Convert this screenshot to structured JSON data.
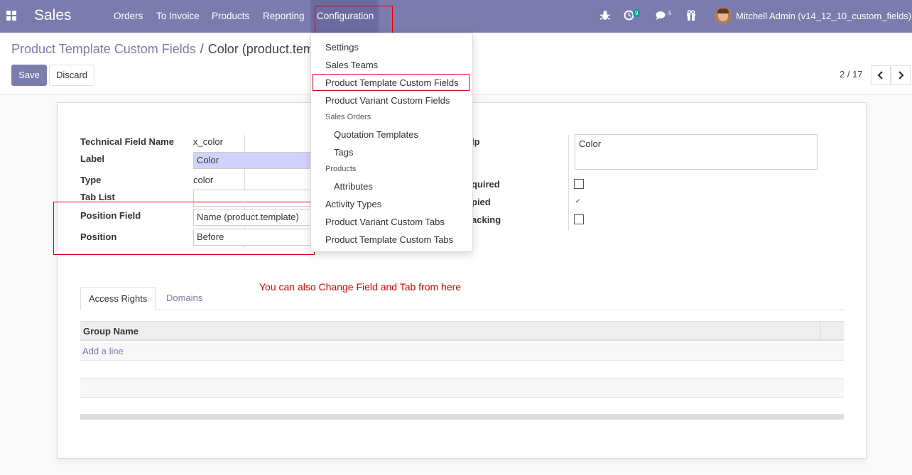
{
  "navbar": {
    "app_name": "Sales",
    "menu": [
      "Orders",
      "To Invoice",
      "Products",
      "Reporting",
      "Configuration"
    ],
    "activity_count": "9",
    "message_count": "5",
    "user": "Mitchell Admin (v14_12_10_custom_fields)"
  },
  "breadcrumb": {
    "parent": "Product Template Custom Fields",
    "separator": "/",
    "current": "Color (product.tem"
  },
  "buttons": {
    "save": "Save",
    "discard": "Discard"
  },
  "pager": {
    "value": "2 / 17",
    "prev": "‹",
    "next": "›"
  },
  "form": {
    "technical_field_name": {
      "label": "Technical Field Name",
      "value": "x_color"
    },
    "label": {
      "label": "Label",
      "value": "Color"
    },
    "type": {
      "label": "Type",
      "value": "color"
    },
    "tab_list": {
      "label": "Tab List",
      "value": ""
    },
    "position_field": {
      "label": "Position Field",
      "value": "Name (product.template)"
    },
    "position": {
      "label": "Position",
      "value": "Before"
    },
    "help": {
      "label": "lp",
      "value": "Color"
    },
    "required": {
      "label": "quired",
      "checked": false
    },
    "copied": {
      "label": "pied",
      "checked": true
    },
    "tracking": {
      "label": "acking",
      "checked": false
    }
  },
  "annotation": "You can also Change Field and Tab from here",
  "tabs": [
    "Access Rights",
    "Domains"
  ],
  "access_table": {
    "column": "Group Name",
    "add_line": "Add a line"
  },
  "dropdown": {
    "items": [
      {
        "label": "Settings",
        "kind": "item"
      },
      {
        "label": "Sales Teams",
        "kind": "item"
      },
      {
        "label": "Product Template Custom Fields",
        "kind": "item"
      },
      {
        "label": "Product Variant Custom Fields",
        "kind": "item"
      },
      {
        "label": "Sales Orders",
        "kind": "header"
      },
      {
        "label": "Quotation Templates",
        "kind": "sub"
      },
      {
        "label": "Tags",
        "kind": "sub"
      },
      {
        "label": "Products",
        "kind": "header"
      },
      {
        "label": "Attributes",
        "kind": "sub"
      },
      {
        "label": "Activity Types",
        "kind": "item"
      },
      {
        "label": "Product Variant Custom Tabs",
        "kind": "item"
      },
      {
        "label": "Product Template Custom Tabs",
        "kind": "item"
      }
    ]
  },
  "colors": {
    "primary": "#7c7bad",
    "annotation": "#d9000d"
  }
}
